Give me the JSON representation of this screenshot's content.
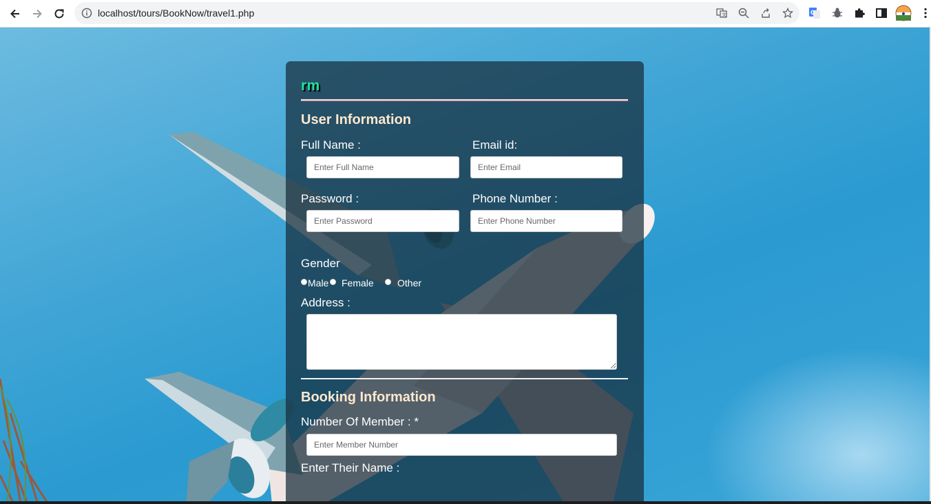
{
  "browser": {
    "url": "localhost/tours/BookNow/travel1.php"
  },
  "form": {
    "logo": "rm",
    "user_section": {
      "title": "User Information",
      "full_name": {
        "label": "Full Name :",
        "placeholder": "Enter Full Name",
        "value": ""
      },
      "email": {
        "label": "Email id:",
        "placeholder": "Enter Email",
        "value": ""
      },
      "password": {
        "label": "Password :",
        "placeholder": "Enter Password",
        "value": ""
      },
      "phone": {
        "label": "Phone Number :",
        "placeholder": "Enter Phone Number",
        "value": ""
      },
      "gender": {
        "label": "Gender",
        "options": [
          "Male",
          "Female",
          "Other"
        ]
      },
      "address": {
        "label": "Address :",
        "value": ""
      }
    },
    "booking_section": {
      "title": "Booking Information",
      "members": {
        "label": "Number Of Member : *",
        "placeholder": "Enter Member Number",
        "value": ""
      },
      "names_label": "Enter Their Name :"
    }
  },
  "colors": {
    "logo": "#1fe0a0",
    "section_title": "#fde8cf",
    "card_bg": "rgba(22,44,58,0.72)",
    "sky": "#2a9ad0"
  }
}
